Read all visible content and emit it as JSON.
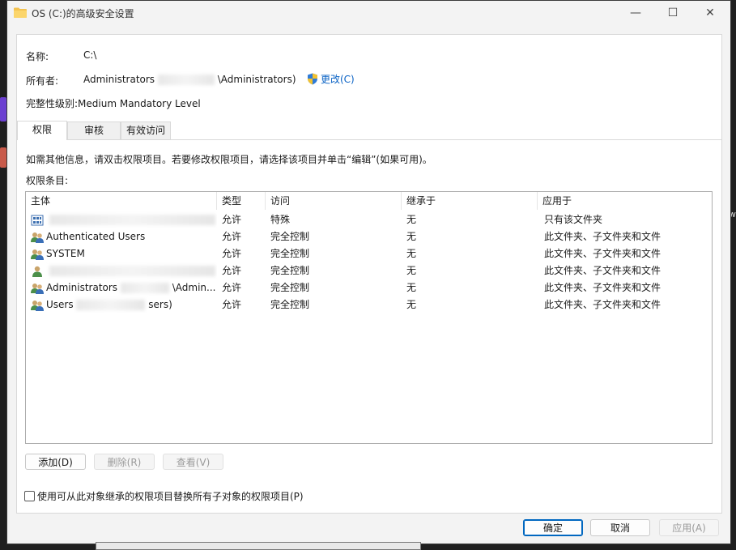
{
  "window": {
    "title": "OS (C:)的高级安全设置",
    "minimize_glyph": "—",
    "maximize_glyph": "☐",
    "close_glyph": "✕"
  },
  "background": {
    "right_char": "w"
  },
  "info": {
    "name_label": "名称:",
    "name_value": "C:\\",
    "owner_label": "所有者:",
    "owner_value_prefix": "Administrators",
    "owner_value_suffix": "\\Administrators)",
    "change_label": "更改(C)",
    "integrity_label": "完整性级别:",
    "integrity_value": "Medium Mandatory Level"
  },
  "tabs": [
    {
      "label": "权限",
      "active": true
    },
    {
      "label": "审核",
      "active": false
    },
    {
      "label": "有效访问",
      "active": false
    }
  ],
  "hint_text": "如需其他信息，请双击权限项目。若要修改权限项目，请选择该项目并单击“编辑”(如果可用)。",
  "entries_label": "权限条目:",
  "table": {
    "columns": [
      "主体",
      "类型",
      "访问",
      "继承于",
      "应用于"
    ],
    "rows": [
      {
        "principal": "",
        "type": "允许",
        "access": "特殊",
        "inherited": "无",
        "applies": "只有该文件夹",
        "icon": "app-package-icon"
      },
      {
        "principal": "Authenticated Users",
        "type": "允许",
        "access": "完全控制",
        "inherited": "无",
        "applies": "此文件夹、子文件夹和文件",
        "icon": "group-users-icon"
      },
      {
        "principal": "SYSTEM",
        "type": "允许",
        "access": "完全控制",
        "inherited": "无",
        "applies": "此文件夹、子文件夹和文件",
        "icon": "group-users-icon"
      },
      {
        "principal": "",
        "type": "允许",
        "access": "完全控制",
        "inherited": "无",
        "applies": "此文件夹、子文件夹和文件",
        "icon": "single-user-icon"
      },
      {
        "principal": "Administrators",
        "principal_suffix": "\\Admin...",
        "type": "允许",
        "access": "完全控制",
        "inherited": "无",
        "applies": "此文件夹、子文件夹和文件",
        "icon": "group-users-icon"
      },
      {
        "principal": "Users",
        "principal_suffix": "sers)",
        "type": "允许",
        "access": "完全控制",
        "inherited": "无",
        "applies": "此文件夹、子文件夹和文件",
        "icon": "group-users-icon"
      }
    ]
  },
  "actions": {
    "add": "添加(D)",
    "remove": "删除(R)",
    "view": "查看(V)"
  },
  "replace_checkbox_label": "使用可从此对象继承的权限项目替换所有子对象的权限项目(P)",
  "footer": {
    "ok": "确定",
    "cancel": "取消",
    "apply": "应用(A)"
  }
}
